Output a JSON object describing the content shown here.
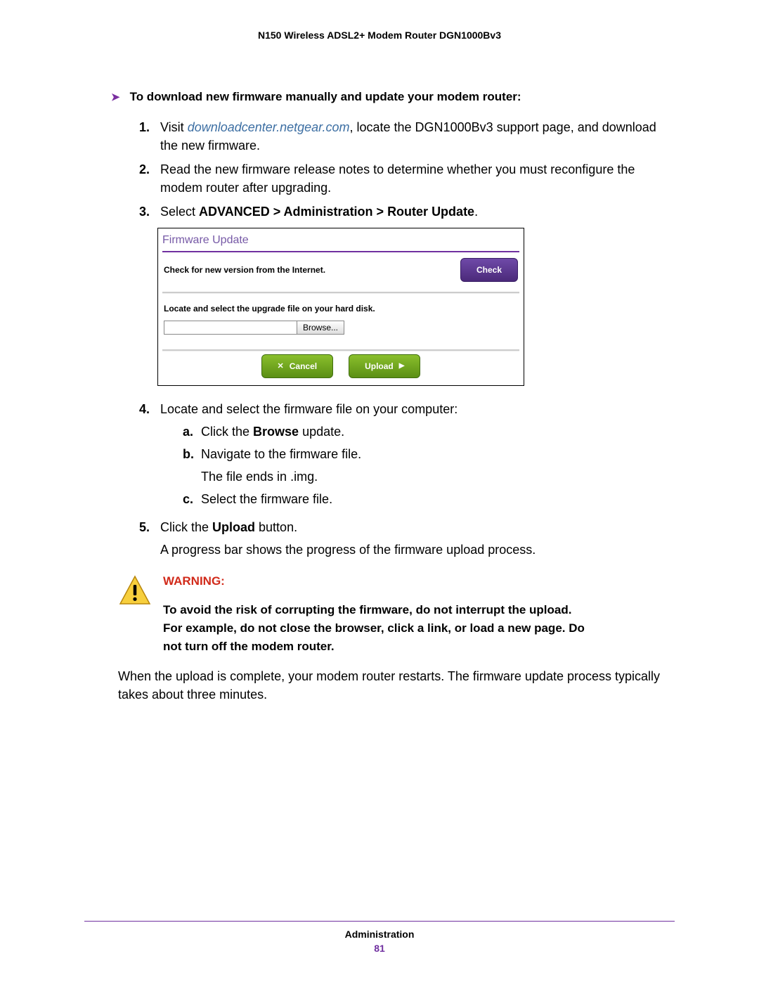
{
  "header": {
    "title": "N150 Wireless ADSL2+ Modem Router DGN1000Bv3"
  },
  "section": {
    "heading": "To download new firmware manually and update your modem router:"
  },
  "steps": {
    "s1": {
      "num": "1.",
      "prefix": "Visit ",
      "link": "downloadcenter.netgear.com",
      "suffix": ", locate the DGN1000Bv3 support page, and download the new firmware."
    },
    "s2": {
      "num": "2.",
      "text": "Read the new firmware release notes to determine whether you must reconfigure the modem router after upgrading."
    },
    "s3": {
      "num": "3.",
      "prefix": "Select ",
      "bold": "ADVANCED > Administration > Router Update",
      "suffix": "."
    },
    "s4": {
      "num": "4.",
      "text": "Locate and select the firmware file on your computer:",
      "sub": {
        "a": {
          "letter": "a.",
          "pre": "Click the ",
          "bold": "Browse",
          "post": " update."
        },
        "b": {
          "letter": "b.",
          "text": "Navigate to the firmware file.",
          "note": "The file ends in .img."
        },
        "c": {
          "letter": "c.",
          "text": "Select the firmware file."
        }
      }
    },
    "s5": {
      "num": "5.",
      "pre": "Click the ",
      "bold": "Upload",
      "post": " button.",
      "after": "A progress bar shows the progress of the firmware upload process."
    }
  },
  "screenshot": {
    "title": "Firmware Update",
    "checkLabel": "Check for new version from the Internet.",
    "checkButton": "Check",
    "locateLabel": "Locate and select the upgrade file on your hard disk.",
    "browseButton": "Browse...",
    "cancelButton": "Cancel",
    "uploadButton": "Upload"
  },
  "warning": {
    "title": "WARNING:",
    "body": "To avoid the risk of corrupting the firmware, do not interrupt the upload. For example, do not close the browser, click a link, or load a new page. Do not turn off the modem router."
  },
  "final": "When the upload is complete, your modem router restarts. The firmware update process typically takes about three minutes.",
  "footer": {
    "title": "Administration",
    "page": "81"
  }
}
